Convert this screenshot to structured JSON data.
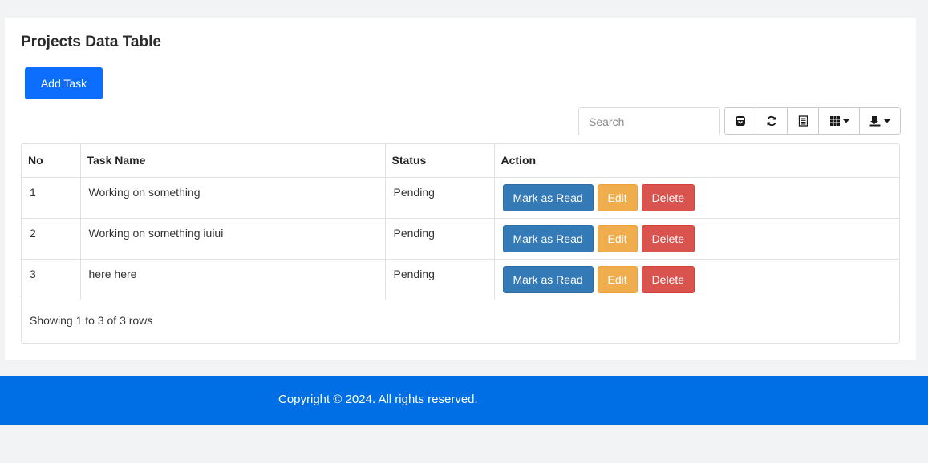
{
  "page": {
    "title": "Projects Data Table",
    "add_button_label": "Add Task"
  },
  "toolbar": {
    "search_placeholder": "Search",
    "buttons": [
      {
        "icon": "toggle-view-icon",
        "dropdown": false
      },
      {
        "icon": "refresh-icon",
        "dropdown": false
      },
      {
        "icon": "toggle-card-icon",
        "dropdown": false
      },
      {
        "icon": "columns-icon",
        "dropdown": true
      },
      {
        "icon": "export-icon",
        "dropdown": true
      }
    ]
  },
  "table": {
    "headers": {
      "no": "No",
      "task_name": "Task Name",
      "status": "Status",
      "action": "Action"
    },
    "rows": [
      {
        "no": "1",
        "task_name": "Working on something",
        "status": "Pending"
      },
      {
        "no": "2",
        "task_name": "Working on something iuiui",
        "status": "Pending"
      },
      {
        "no": "3",
        "task_name": "here here",
        "status": "Pending"
      }
    ],
    "actions": {
      "mark_read": "Mark as Read",
      "edit": "Edit",
      "delete": "Delete"
    },
    "pagination_info": "Showing 1 to 3 of 3 rows"
  },
  "footer": {
    "copyright": "Copyright © 2024. All rights reserved."
  },
  "colors": {
    "primary": "#0d6efd",
    "footer": "#006fe6",
    "mark_read": "#337ab7",
    "edit": "#f0ad4e",
    "delete": "#d9534f"
  }
}
